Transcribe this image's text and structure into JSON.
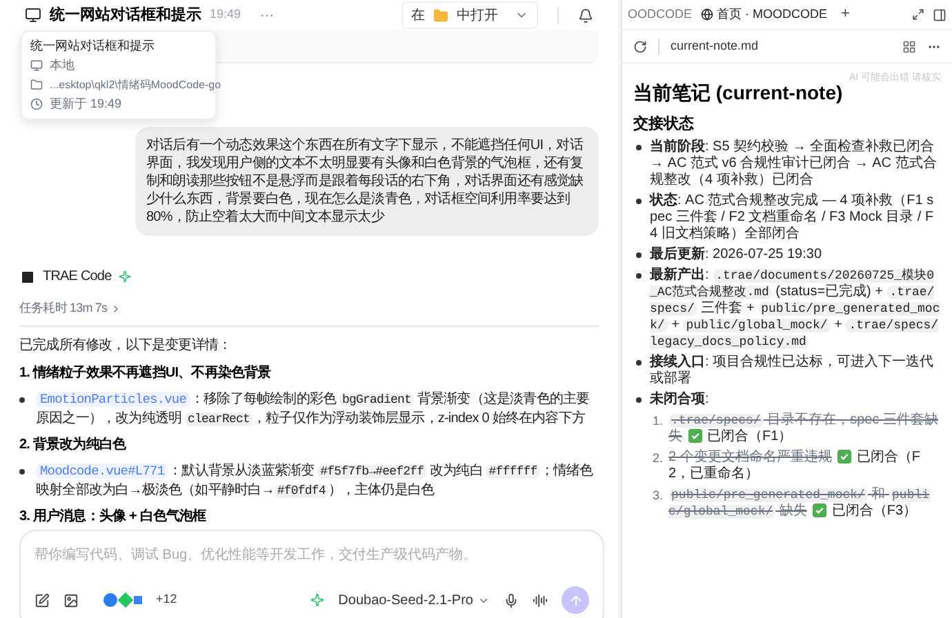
{
  "header": {
    "title": "统一网站对话框和提示",
    "time": "19:49",
    "more": "···",
    "open_button": {
      "prefix": "在",
      "suffix": "中打开"
    }
  },
  "tooltip": {
    "title": "统一网站对话框和提示",
    "location": "本地",
    "path": "...esktop\\qkl2\\情绪码MoodCode-go",
    "updated": "更新于 19:49"
  },
  "user_message": "对话后有一个动态效果这个东西在所有文字下显示，不能遮挡任何UI，对话界面，我发现用户侧的文本不太明显要有头像和白色背景的气泡框，还有复制和朗读那些按钮不是悬浮而是跟着每段话的右下角，对话界面还有感觉缺少什么东西，背景要白色，现在怎么是淡青色，对话框空间利用率要达到80%，防止空着太大而中间文本显示太少",
  "assistant": {
    "name": "TRAE Code",
    "duration": "任务耗时 13m 7s",
    "blocks": [
      {
        "kind": "para",
        "segments": [
          {
            "kind": "text",
            "text": "已完成所有修改，以下是变更详情："
          }
        ]
      },
      {
        "kind": "heading",
        "segments": [
          {
            "kind": "text",
            "text": "1. 情绪粒子效果不再遮挡UI、不再染色背景"
          }
        ]
      },
      {
        "kind": "bullet",
        "segments": [
          {
            "kind": "link",
            "text": "EmotionParticles.vue"
          },
          {
            "kind": "text",
            "text": "：移除了每帧绘制的彩色 "
          },
          {
            "kind": "code",
            "text": "bgGradient"
          },
          {
            "kind": "text",
            "text": " 背景渐变（这是淡青色的主要原因之一），改为纯透明 "
          },
          {
            "kind": "code",
            "text": "clearRect"
          },
          {
            "kind": "text",
            "text": "，粒子仅作为浮动装饰层显示，z-index 0 始终在内容下方"
          }
        ]
      },
      {
        "kind": "heading",
        "segments": [
          {
            "kind": "text",
            "text": "2. 背景改为纯白色"
          }
        ]
      },
      {
        "kind": "bullet",
        "segments": [
          {
            "kind": "link",
            "text": "Moodcode.vue#L771"
          },
          {
            "kind": "text",
            "text": "：默认背景从淡蓝紫渐变 "
          },
          {
            "kind": "code",
            "text": "#f5f7fb→#eef2ff"
          },
          {
            "kind": "text",
            "text": " 改为纯白 "
          },
          {
            "kind": "code",
            "text": "#ffffff"
          },
          {
            "kind": "text",
            "text": "；情绪色映射全部改为白→极淡色（如平静时白→"
          },
          {
            "kind": "code",
            "text": "#f0fdf4"
          },
          {
            "kind": "text",
            "text": "），主体仍是白色"
          }
        ]
      },
      {
        "kind": "heading",
        "segments": [
          {
            "kind": "text",
            "text": "3. 用户消息：头像 + 白色气泡框"
          }
        ]
      }
    ]
  },
  "composer": {
    "placeholder": "帮你编写代码、调试 Bug、优化性能等开发工作，交付生产级代码产物。",
    "plugin_count": "+12",
    "model": "Doubao-Seed-2.1-Pro"
  },
  "right_panel": {
    "tabs": [
      {
        "label": "OODCODE",
        "selected": false
      },
      {
        "label": "首页 · MOODCODE",
        "selected": true
      }
    ],
    "add": "+",
    "file": "current-note.md",
    "notice": "AI 可能会出错 请核实",
    "title": "当前笔记 (current-note)",
    "section": "交接状态",
    "bullets": [
      {
        "segments": [
          {
            "kind": "bold",
            "text": "当前阶段"
          },
          {
            "kind": "text",
            "text": ": S5 契约校验 → 全面检查补救已闭合 → AC 范式 v6 合规性审计已闭合 → AC 范式合规整改（4 项补救）已闭合"
          }
        ]
      },
      {
        "segments": [
          {
            "kind": "bold",
            "text": "状态"
          },
          {
            "kind": "text",
            "text": ": AC 范式合规整改完成 — 4 项补救（F1 spec 三件套 / F2 文档重命名 / F3 Mock 目录 / F4 旧文档策略）全部闭合"
          }
        ]
      },
      {
        "segments": [
          {
            "kind": "bold",
            "text": "最后更新"
          },
          {
            "kind": "text",
            "text": ": 2026-07-25 19:30"
          }
        ]
      },
      {
        "segments": [
          {
            "kind": "bold",
            "text": "最新产出"
          },
          {
            "kind": "text",
            "text": ": "
          },
          {
            "kind": "code",
            "text": ".trae/documents/20260725_模块0_AC范式合规整改.md"
          },
          {
            "kind": "text",
            "text": " (status=已完成) + "
          },
          {
            "kind": "code",
            "text": ".trae/specs/"
          },
          {
            "kind": "text",
            "text": " 三件套 + "
          },
          {
            "kind": "code",
            "text": "public/pre_generated_mock/"
          },
          {
            "kind": "text",
            "text": " + "
          },
          {
            "kind": "code",
            "text": "public/global_mock/"
          },
          {
            "kind": "text",
            "text": " + "
          },
          {
            "kind": "code",
            "text": ".trae/specs/legacy_docs_policy.md"
          }
        ]
      },
      {
        "segments": [
          {
            "kind": "bold",
            "text": "接续入口"
          },
          {
            "kind": "text",
            "text": ": 项目合规性已达标，可进入下一迭代或部署"
          }
        ]
      },
      {
        "segments": [
          {
            "kind": "bold",
            "text": "未闭合项"
          },
          {
            "kind": "text",
            "text": ":"
          }
        ]
      }
    ],
    "open_items": [
      {
        "number": "1.",
        "struck": [
          {
            "kind": "code",
            "text": ".trae/specs/"
          },
          {
            "kind": "text",
            "text": " 目录不存在，spec 三件套缺失"
          }
        ],
        "done": true,
        "result": "已闭合（F1）"
      },
      {
        "number": "2.",
        "struck": [
          {
            "kind": "text",
            "text": "2 个变更文档命名严重违规"
          }
        ],
        "done": true,
        "result": "已闭合（F2，已重命名）"
      },
      {
        "number": "3.",
        "struck": [
          {
            "kind": "code",
            "text": "public/pre_generated_mock/"
          },
          {
            "kind": "text",
            "text": " 和 "
          },
          {
            "kind": "code",
            "text": "public/global_mock/"
          },
          {
            "kind": "text",
            "text": " 缺失"
          }
        ],
        "done": true,
        "result": "已闭合（F3）"
      }
    ]
  }
}
